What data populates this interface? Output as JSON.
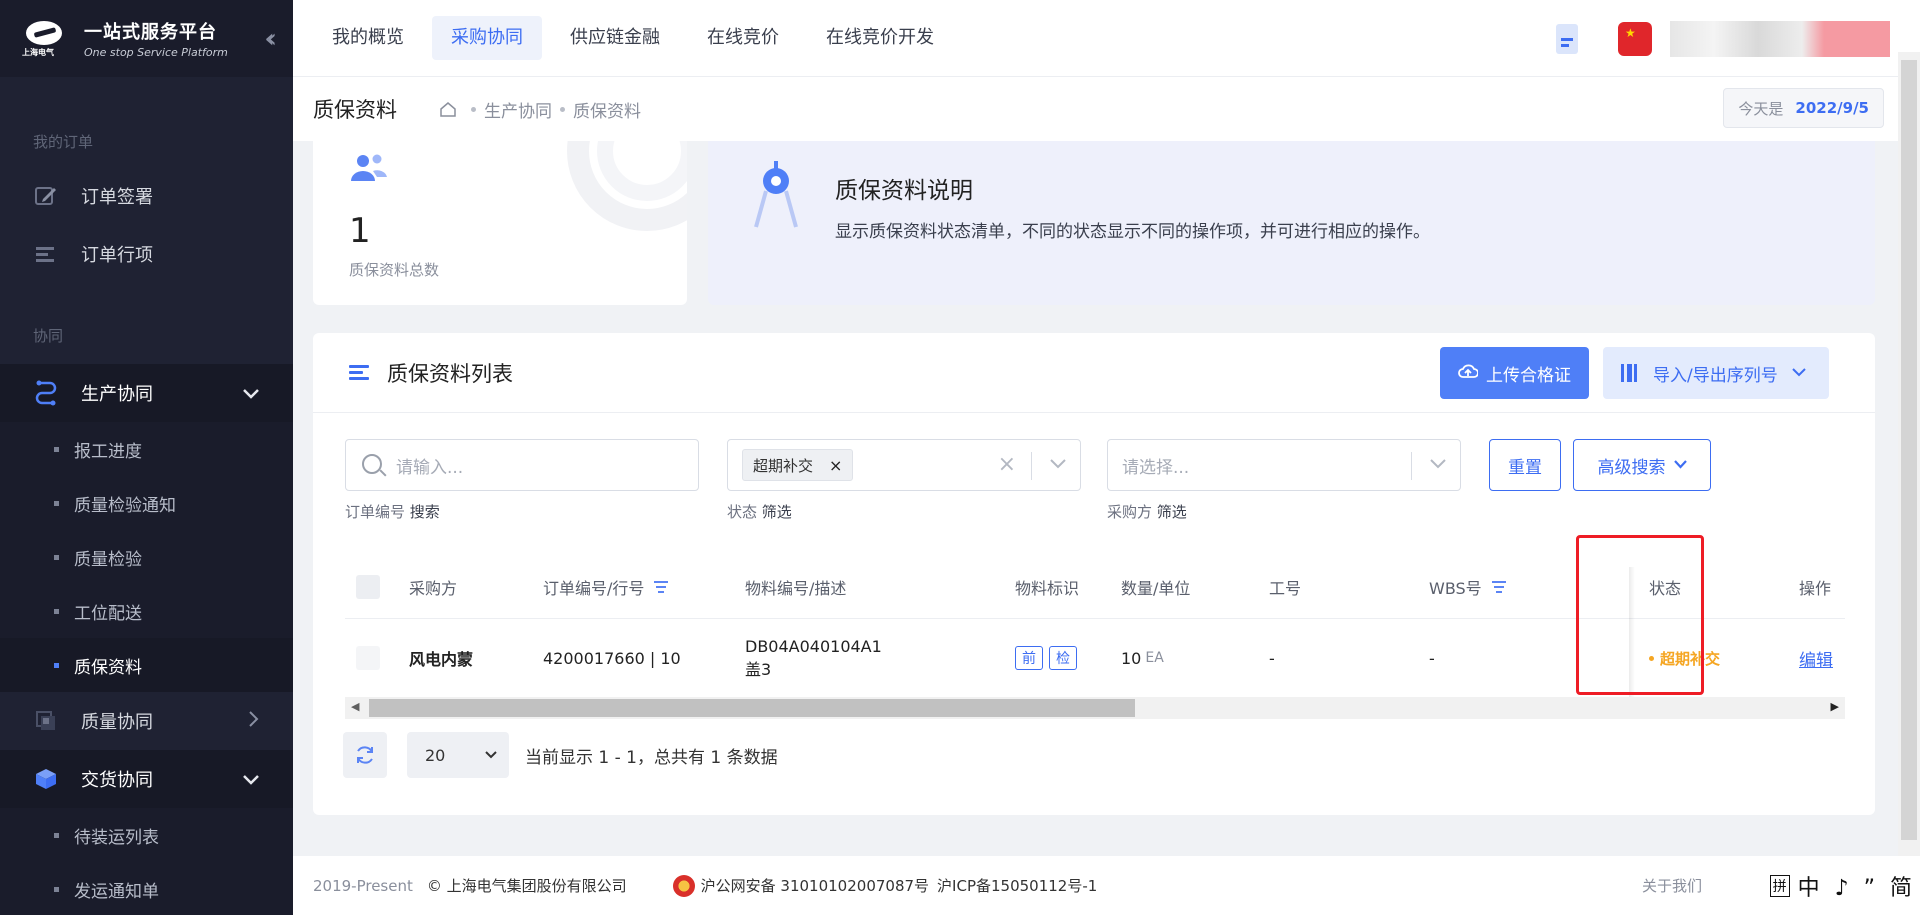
{
  "brand": {
    "logo_sub": "上海电气",
    "title_cn": "一站式服务平台",
    "title_en": "One stop Service Platform"
  },
  "sidebar": {
    "section_orders": "我的订单",
    "orders": [
      {
        "label": "订单签署",
        "icon": "edit-icon"
      },
      {
        "label": "订单行项",
        "icon": "list-icon"
      }
    ],
    "section_collab": "协同",
    "production": {
      "label": "生产协同",
      "icon": "route-icon",
      "children": [
        "报工进度",
        "质量检验通知",
        "质量检验",
        "工位配送",
        "质保资料"
      ],
      "active": "质保资料"
    },
    "quality": {
      "label": "质量协同",
      "icon": "layers-icon"
    },
    "delivery": {
      "label": "交货协同",
      "icon": "box-icon",
      "children": [
        "待装运列表",
        "发运通知单"
      ]
    }
  },
  "topnav": {
    "tabs": [
      "我的概览",
      "采购协同",
      "供应链金融",
      "在线竞价",
      "在线竞价开发"
    ],
    "active": "采购协同"
  },
  "subheader": {
    "title": "质保资料",
    "breadcrumb": [
      "生产协同",
      "质保资料"
    ],
    "date_label": "今天是",
    "date_value": "2022/9/5"
  },
  "stat": {
    "value": "1",
    "label": "质保资料总数"
  },
  "info": {
    "title": "质保资料说明",
    "desc": "显示质保资料状态清单，不同的状态显示不同的操作项，并可进行相应的操作。"
  },
  "list": {
    "title": "质保资料列表",
    "upload_btn": "上传合格证",
    "import_btn": "导入/导出序列号"
  },
  "filters": {
    "search_placeholder": "请输入...",
    "search_hint_prefix": "订单编号",
    "search_hint_action": "搜索",
    "status_chip": "超期补交",
    "status_hint_prefix": "状态",
    "status_hint_action": "筛选",
    "buyer_placeholder": "请选择...",
    "buyer_hint_prefix": "采购方",
    "buyer_hint_action": "筛选",
    "reset_btn": "重置",
    "advanced_btn": "高级搜索"
  },
  "table": {
    "headers": [
      "采购方",
      "订单编号/行号",
      "物料编号/描述",
      "物料标识",
      "数量/单位",
      "工号",
      "WBS号",
      "状态",
      "操作"
    ],
    "rows": [
      {
        "buyer": "风电内蒙",
        "order": "4200017660 | 10",
        "material_code": "DB04A040104A1",
        "material_desc": "盖3",
        "tags": [
          "前",
          "检"
        ],
        "qty": "10",
        "unit": "EA",
        "job_no": "-",
        "wbs": "-",
        "status": "超期补交",
        "action": "编辑"
      }
    ]
  },
  "pager": {
    "page_size": "20",
    "summary": "当前显示 1 - 1，总共有 1 条数据"
  },
  "footer": {
    "copyright_years": "2019-Present",
    "company": "© 上海电气集团股份有限公司",
    "police": "沪公网安备 31010102007087号",
    "icp": "沪ICP备15050112号-1",
    "about": "关于我们",
    "ime": "中 ♪ ” 简"
  },
  "colors": {
    "sidebar_bg": "#1f2233",
    "accent": "#3d6df2",
    "warning": "#f5a623",
    "highlight": "#ee1c25"
  }
}
